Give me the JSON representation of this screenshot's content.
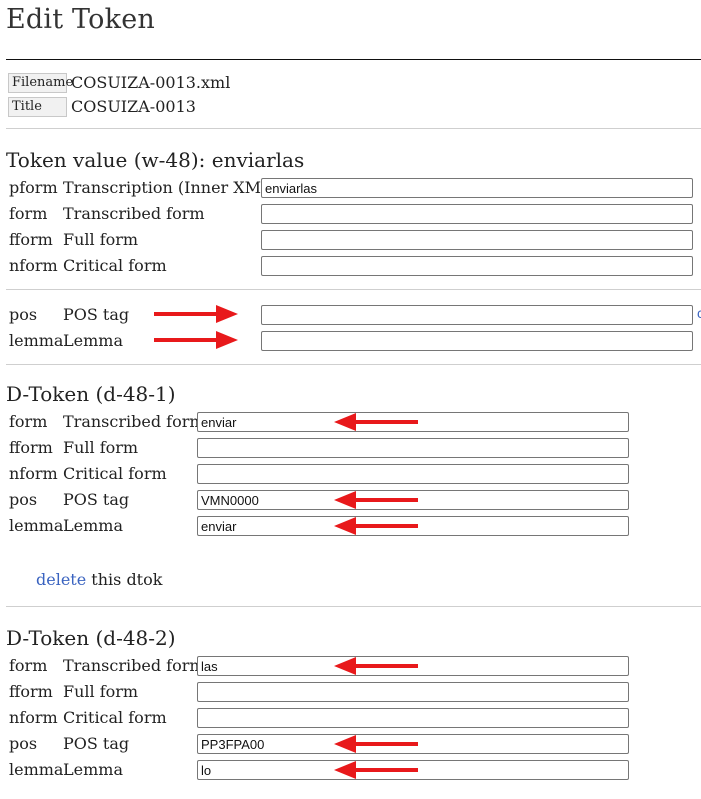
{
  "page": {
    "title": "Edit Token"
  },
  "meta": {
    "filename_label": "Filename",
    "filename_value": "COSUIZA-0013.xml",
    "title_label": "Title",
    "title_value": "COSUIZA-0013"
  },
  "token": {
    "heading": "Token value (w-48): enviarlas",
    "rows": [
      {
        "code": "pform",
        "label": "Transcription (Inner XML)",
        "value": "enviarlas"
      },
      {
        "code": "form",
        "label": "Transcribed form",
        "value": ""
      },
      {
        "code": "fform",
        "label": "Full form",
        "value": ""
      },
      {
        "code": "nform",
        "label": "Critical form",
        "value": ""
      }
    ],
    "annotations": [
      {
        "code": "pos",
        "label": "POS tag",
        "value": ""
      },
      {
        "code": "lemma",
        "label": "Lemma",
        "value": ""
      }
    ]
  },
  "dtokens": [
    {
      "heading": "D-Token (d-48-1)",
      "rows": [
        {
          "code": "form",
          "label": "Transcribed form",
          "value": "enviar"
        },
        {
          "code": "fform",
          "label": "Full form",
          "value": ""
        },
        {
          "code": "nform",
          "label": "Critical form",
          "value": ""
        },
        {
          "code": "pos",
          "label": "POS tag",
          "value": "VMN0000"
        },
        {
          "code": "lemma",
          "label": "Lemma",
          "value": "enviar"
        }
      ],
      "delete_link": "delete",
      "delete_suffix": " this dtok"
    },
    {
      "heading": "D-Token (d-48-2)",
      "rows": [
        {
          "code": "form",
          "label": "Transcribed form",
          "value": "las"
        },
        {
          "code": "fform",
          "label": "Full form",
          "value": ""
        },
        {
          "code": "nform",
          "label": "Critical form",
          "value": ""
        },
        {
          "code": "pos",
          "label": "POS tag",
          "value": "PP3FPA00"
        },
        {
          "code": "lemma",
          "label": "Lemma",
          "value": "lo"
        }
      ]
    }
  ],
  "colors": {
    "arrow": "#e8191b",
    "link": "#3a63c0"
  },
  "icons": {
    "arrow": "red-arrow-annotation"
  }
}
